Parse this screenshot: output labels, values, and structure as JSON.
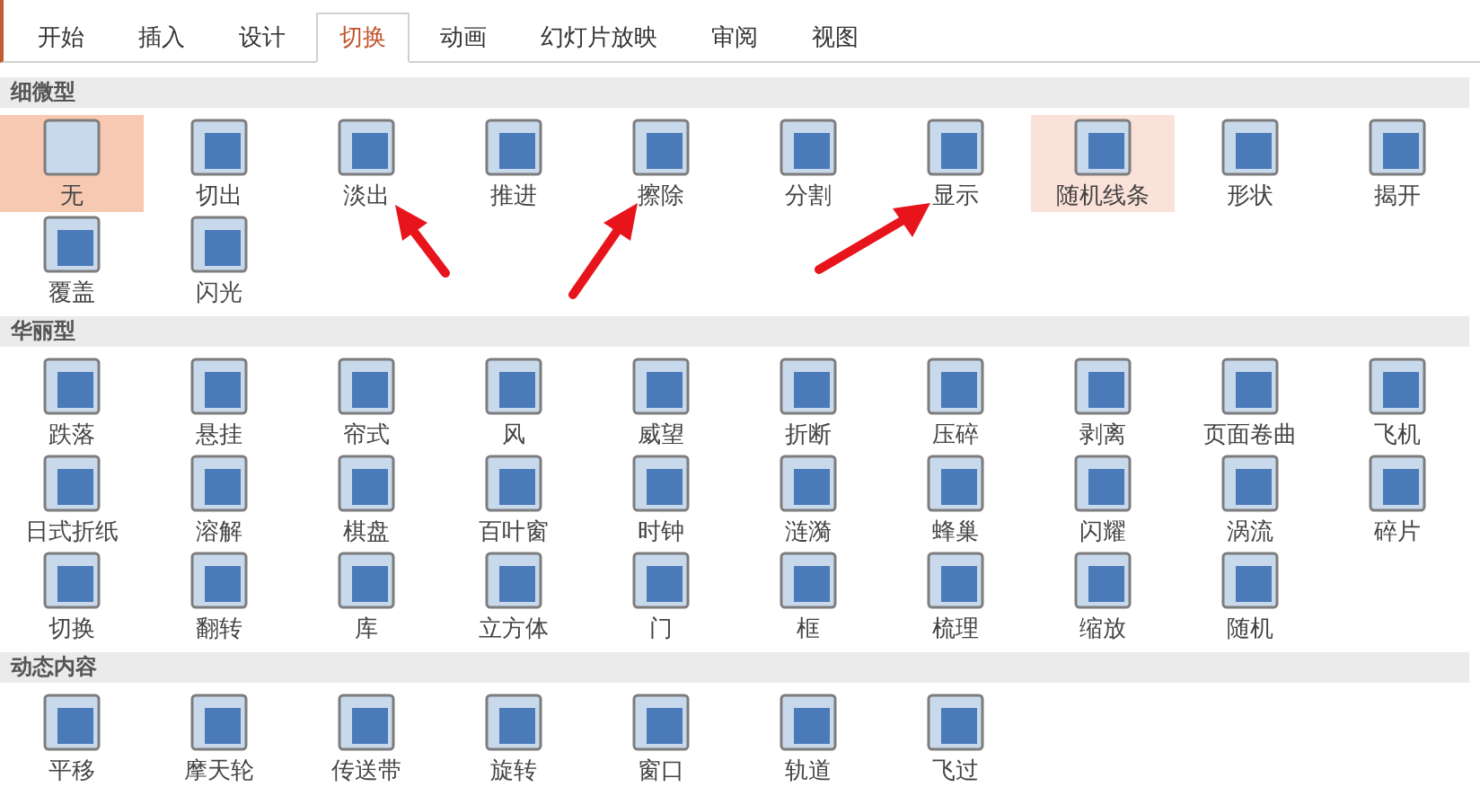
{
  "tabs": [
    {
      "label": "开始",
      "selected": false
    },
    {
      "label": "插入",
      "selected": false
    },
    {
      "label": "设计",
      "selected": false
    },
    {
      "label": "切换",
      "selected": true
    },
    {
      "label": "动画",
      "selected": false
    },
    {
      "label": "幻灯片放映",
      "selected": false
    },
    {
      "label": "审阅",
      "selected": false
    },
    {
      "label": "视图",
      "selected": false
    }
  ],
  "sections": [
    {
      "title": "细微型",
      "items": [
        {
          "label": "无",
          "selected": true,
          "hovered": false
        },
        {
          "label": "切出",
          "selected": false,
          "hovered": false
        },
        {
          "label": "淡出",
          "selected": false,
          "hovered": false
        },
        {
          "label": "推进",
          "selected": false,
          "hovered": false
        },
        {
          "label": "擦除",
          "selected": false,
          "hovered": false
        },
        {
          "label": "分割",
          "selected": false,
          "hovered": false
        },
        {
          "label": "显示",
          "selected": false,
          "hovered": false
        },
        {
          "label": "随机线条",
          "selected": false,
          "hovered": true
        },
        {
          "label": "形状",
          "selected": false,
          "hovered": false
        },
        {
          "label": "揭开",
          "selected": false,
          "hovered": false
        },
        {
          "label": "覆盖",
          "selected": false,
          "hovered": false
        },
        {
          "label": "闪光",
          "selected": false,
          "hovered": false
        }
      ]
    },
    {
      "title": "华丽型",
      "items": [
        {
          "label": "跌落",
          "selected": false,
          "hovered": false
        },
        {
          "label": "悬挂",
          "selected": false,
          "hovered": false
        },
        {
          "label": "帘式",
          "selected": false,
          "hovered": false
        },
        {
          "label": "风",
          "selected": false,
          "hovered": false
        },
        {
          "label": "威望",
          "selected": false,
          "hovered": false
        },
        {
          "label": "折断",
          "selected": false,
          "hovered": false
        },
        {
          "label": "压碎",
          "selected": false,
          "hovered": false
        },
        {
          "label": "剥离",
          "selected": false,
          "hovered": false
        },
        {
          "label": "页面卷曲",
          "selected": false,
          "hovered": false
        },
        {
          "label": "飞机",
          "selected": false,
          "hovered": false
        },
        {
          "label": "日式折纸",
          "selected": false,
          "hovered": false
        },
        {
          "label": "溶解",
          "selected": false,
          "hovered": false
        },
        {
          "label": "棋盘",
          "selected": false,
          "hovered": false
        },
        {
          "label": "百叶窗",
          "selected": false,
          "hovered": false
        },
        {
          "label": "时钟",
          "selected": false,
          "hovered": false
        },
        {
          "label": "涟漪",
          "selected": false,
          "hovered": false
        },
        {
          "label": "蜂巢",
          "selected": false,
          "hovered": false
        },
        {
          "label": "闪耀",
          "selected": false,
          "hovered": false
        },
        {
          "label": "涡流",
          "selected": false,
          "hovered": false
        },
        {
          "label": "碎片",
          "selected": false,
          "hovered": false
        },
        {
          "label": "切换",
          "selected": false,
          "hovered": false
        },
        {
          "label": "翻转",
          "selected": false,
          "hovered": false
        },
        {
          "label": "库",
          "selected": false,
          "hovered": false
        },
        {
          "label": "立方体",
          "selected": false,
          "hovered": false
        },
        {
          "label": "门",
          "selected": false,
          "hovered": false
        },
        {
          "label": "框",
          "selected": false,
          "hovered": false
        },
        {
          "label": "梳理",
          "selected": false,
          "hovered": false
        },
        {
          "label": "缩放",
          "selected": false,
          "hovered": false
        },
        {
          "label": "随机",
          "selected": false,
          "hovered": false
        }
      ]
    },
    {
      "title": "动态内容",
      "items": [
        {
          "label": "平移",
          "selected": false,
          "hovered": false
        },
        {
          "label": "摩天轮",
          "selected": false,
          "hovered": false
        },
        {
          "label": "传送带",
          "selected": false,
          "hovered": false
        },
        {
          "label": "旋转",
          "selected": false,
          "hovered": false
        },
        {
          "label": "窗口",
          "selected": false,
          "hovered": false
        },
        {
          "label": "轨道",
          "selected": false,
          "hovered": false
        },
        {
          "label": "飞过",
          "selected": false,
          "hovered": false
        }
      ]
    }
  ]
}
